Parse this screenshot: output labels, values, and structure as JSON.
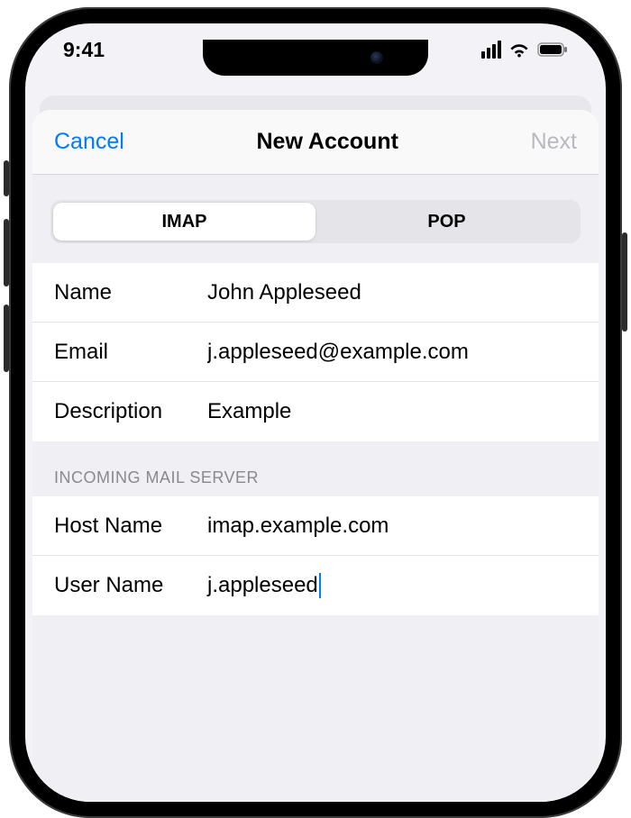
{
  "statusbar": {
    "time": "9:41"
  },
  "navbar": {
    "cancel": "Cancel",
    "title": "New Account",
    "next": "Next",
    "next_enabled": false
  },
  "segmented": {
    "options": [
      "IMAP",
      "POP"
    ],
    "selected_index": 0
  },
  "account_fields": [
    {
      "label": "Name",
      "value": "John Appleseed"
    },
    {
      "label": "Email",
      "value": "j.appleseed@example.com"
    },
    {
      "label": "Description",
      "value": "Example"
    }
  ],
  "incoming_header": "INCOMING MAIL SERVER",
  "incoming_fields": [
    {
      "label": "Host Name",
      "value": "imap.example.com"
    },
    {
      "label": "User Name",
      "value": "j.appleseed",
      "focused": true
    }
  ],
  "colors": {
    "accent": "#007aff",
    "disabled": "#b9b9bf",
    "grouped_bg": "#efeff4"
  }
}
